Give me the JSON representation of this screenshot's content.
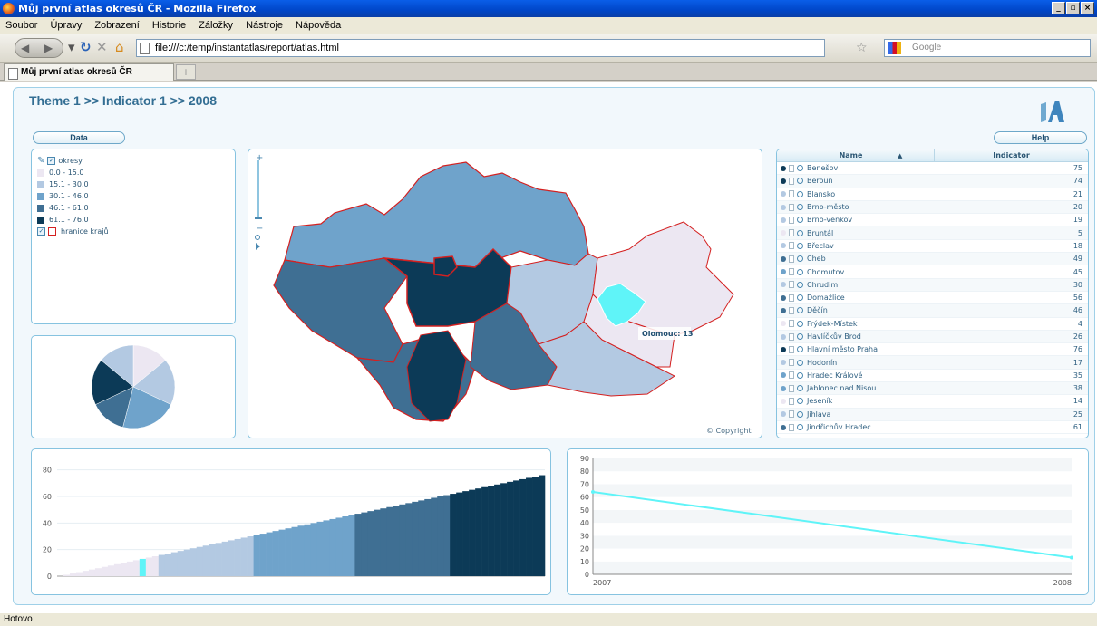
{
  "window": {
    "title": "Můj první atlas okresů ČR - Mozilla Firefox",
    "btn_min": "_",
    "btn_max": "▫",
    "btn_close": "×"
  },
  "menu": [
    "Soubor",
    "Úpravy",
    "Zobrazení",
    "Historie",
    "Záložky",
    "Nástroje",
    "Nápověda"
  ],
  "nav": {
    "url": "file:///c:/temp/instantatlas/report/atlas.html",
    "search_placeholder": "Google"
  },
  "tabs": {
    "active": "Můj první atlas okresů ČR",
    "new_tab": "+"
  },
  "status": "Hotovo",
  "atlas": {
    "heading": "Theme 1 >> Indicator 1 >> 2008",
    "data_button": "Data",
    "help_button": "Help",
    "copyright": "© Copyright",
    "tooltip": "Olomouc: 13",
    "colors": {
      "c1": "#ece7f2",
      "c2": "#b3c9e2",
      "c3": "#6fa3cb",
      "c4": "#3f6f93",
      "c5": "#0c3a57",
      "highlight": "#5ff4f8"
    },
    "legend": {
      "layer": "okresy",
      "classes": [
        "0.0 - 15.0",
        "15.1 - 30.0",
        "30.1 - 46.0",
        "46.1 - 61.0",
        "61.1 - 76.0"
      ],
      "boundary": "hranice krajů"
    },
    "table": {
      "col_name": "Name",
      "col_value": "Indicator",
      "sort_icon": "▲",
      "rows": [
        {
          "name": "Benešov",
          "value": "75",
          "cls": 5
        },
        {
          "name": "Beroun",
          "value": "74",
          "cls": 5
        },
        {
          "name": "Blansko",
          "value": "21",
          "cls": 2
        },
        {
          "name": "Brno-město",
          "value": "20",
          "cls": 2
        },
        {
          "name": "Brno-venkov",
          "value": "19",
          "cls": 2
        },
        {
          "name": "Bruntál",
          "value": "5",
          "cls": 1
        },
        {
          "name": "Břeclav",
          "value": "18",
          "cls": 2
        },
        {
          "name": "Cheb",
          "value": "49",
          "cls": 4
        },
        {
          "name": "Chomutov",
          "value": "45",
          "cls": 3
        },
        {
          "name": "Chrudim",
          "value": "30",
          "cls": 2
        },
        {
          "name": "Domažlice",
          "value": "56",
          "cls": 4
        },
        {
          "name": "Děčín",
          "value": "46",
          "cls": 4
        },
        {
          "name": "Frýdek-Místek",
          "value": "4",
          "cls": 1
        },
        {
          "name": "Havlíčkův Brod",
          "value": "26",
          "cls": 2
        },
        {
          "name": "Hlavní město Praha",
          "value": "76",
          "cls": 5
        },
        {
          "name": "Hodonín",
          "value": "17",
          "cls": 2
        },
        {
          "name": "Hradec Králové",
          "value": "35",
          "cls": 3
        },
        {
          "name": "Jablonec nad Nisou",
          "value": "38",
          "cls": 3
        },
        {
          "name": "Jeseník",
          "value": "14",
          "cls": 1
        },
        {
          "name": "Jihlava",
          "value": "25",
          "cls": 2
        },
        {
          "name": "Jindřichův Hradec",
          "value": "61",
          "cls": 4
        }
      ]
    }
  },
  "chart_data": [
    {
      "type": "pie",
      "values": [
        14,
        18,
        22,
        14,
        18,
        14
      ],
      "colors": [
        "#ece7f2",
        "#b3c9e2",
        "#6fa3cb",
        "#3f6f93",
        "#0c3a57",
        "#b3c9e2"
      ]
    },
    {
      "type": "bar",
      "yticks": [
        "0",
        "20",
        "40",
        "60",
        "80"
      ],
      "ylim": [
        0,
        90
      ],
      "n_bars": 77,
      "min": 0,
      "max": 76,
      "highlight_value": 13
    },
    {
      "type": "line",
      "x": [
        "2007",
        "2008"
      ],
      "y": [
        64,
        13
      ],
      "yticks": [
        "0",
        "10",
        "20",
        "30",
        "40",
        "50",
        "60",
        "70",
        "80",
        "90"
      ],
      "ylim": [
        0,
        90
      ],
      "line_color": "#5ff4f8"
    }
  ]
}
